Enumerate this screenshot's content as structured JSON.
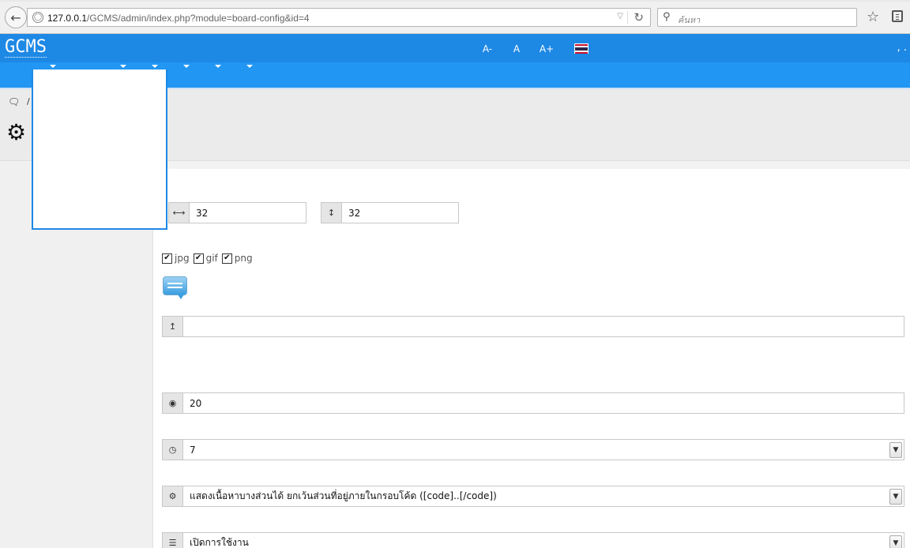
{
  "browser": {
    "url_host": "127.0.0.1",
    "url_path": "/GCMS/admin/index.php?module=board-config&id=4",
    "search_placeholder": "ค้นหา"
  },
  "header": {
    "logo": "GCMS",
    "font_buttons": [
      "A-",
      "A",
      "A+"
    ],
    "user_text": ", ."
  },
  "title_area": {
    "breadcrumb_separator": "/"
  },
  "form": {
    "stray_text": ")",
    "width_value": "32",
    "height_value": "32",
    "file_types": [
      {
        "label": "jpg",
        "checked": true
      },
      {
        "label": "gif",
        "checked": true
      },
      {
        "label": "png",
        "checked": true
      }
    ],
    "upload_value": "",
    "views_value": "20",
    "time_value": "7",
    "display_value": "แสดงเนื้อหาบางส่วนได้ ยกเว้นส่วนที่อยู่ภายในกรอบโค้ด ([code]..[/code])",
    "status_value": "เปิดการใช้งาน"
  },
  "colors": {
    "header": "#1e88e5",
    "menu": "#2196f3"
  }
}
